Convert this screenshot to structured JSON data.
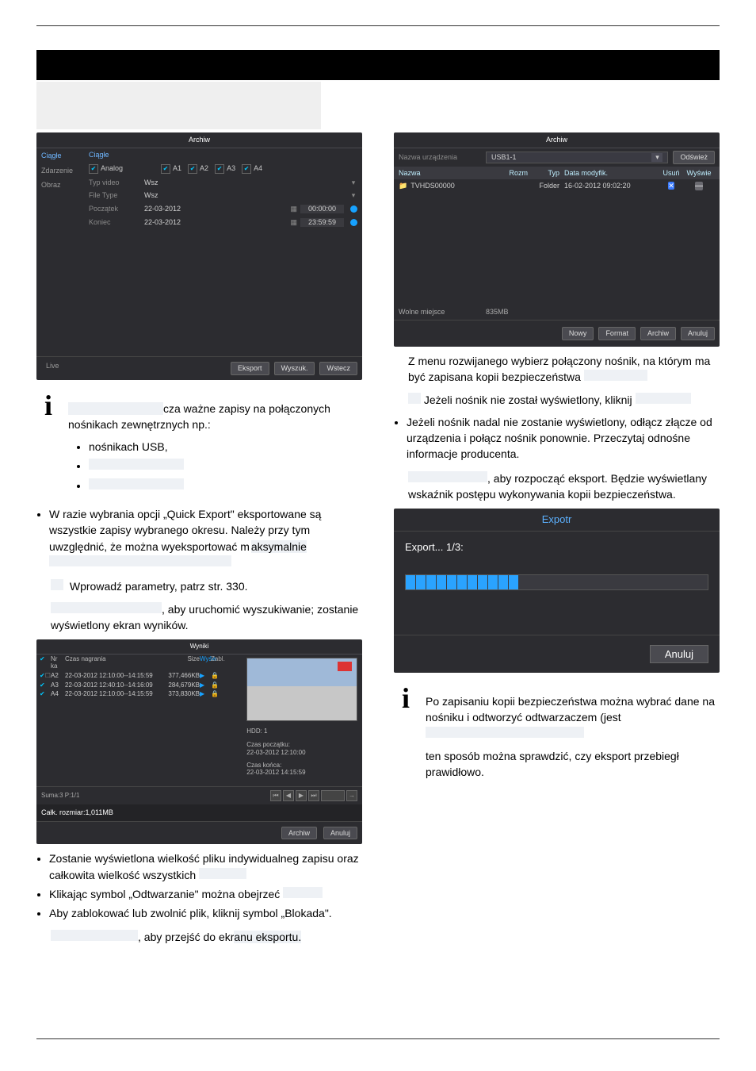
{
  "section_number": "",
  "ss1": {
    "title": "Archiw",
    "sidebar": [
      "Ciągłe",
      "Zdarzenie",
      "Obraz",
      "Live"
    ],
    "tab_active": "Ciągłe",
    "analog_label": "Analog",
    "chs": [
      "A1",
      "A2",
      "A3",
      "A4"
    ],
    "rows": [
      {
        "label": "Typ video",
        "value": "Wsz"
      },
      {
        "label": "File Type",
        "value": "Wsz"
      },
      {
        "label": "Początek",
        "value": "22-03-2012",
        "time": "00:00:00"
      },
      {
        "label": "Koniec",
        "value": "22-03-2012",
        "time": "23:59:59"
      }
    ],
    "buttons": [
      "Eksport",
      "Wyszuk.",
      "Wstecz"
    ]
  },
  "intro_right": "cza ważne zapisy na połączonych nośnikach zewnętrznych np.:",
  "media_list": [
    "nośnikach USB,",
    "",
    ""
  ],
  "quick_export": "W razie wybrania opcji „Quick Export\" eksportowane są wszystkie zapisy wybranego okresu. Należy przy tym uwzględnić, że można wyeksportować m",
  "enter_params_label": "Wprowadź parametry, patrz str. 330.",
  "search_line": ", aby uruchomić wyszukiwanie; zostanie wyświetlony ekran wyników.",
  "ss2": {
    "title": "Wyniki",
    "head": [
      "Nr ka",
      "Czas nagrania",
      "Size",
      "Wyśw",
      "Zabl."
    ],
    "rows": [
      {
        "ch": "A2",
        "time": "22-03-2012 12:10:00--14:15:59",
        "size": "377,466KB"
      },
      {
        "ch": "A3",
        "time": "22-03-2012 12:40:10--14:16:09",
        "size": "284,679KB"
      },
      {
        "ch": "A4",
        "time": "22-03-2012 12:10:00--14:15:59",
        "size": "373,830KB"
      }
    ],
    "hdd": "HDD: 1",
    "start_lbl": "Czas początku:",
    "start_val": "22-03-2012 12:10:00",
    "end_lbl": "Czas końca:",
    "end_val": "22-03-2012 14:15:59",
    "sum": "Suma:3 P:1/1",
    "total": "Całk. rozmiar:1,011MB",
    "buttons": [
      "Archiw",
      "Anuluj"
    ]
  },
  "below_results": [
    "Zostanie wyświetlona wielkość pliku indywidualneg zapisu oraz całkowita wielkość wszystkich",
    "Klikając symbol „Odtwarzanie\" można obejrzeć",
    "Aby zablokować lub zwolnić plik, kliknij symbol „Blokada\"."
  ],
  "goto_line": ", aby przejść do ekr",
  "ss3": {
    "title": "Archiw",
    "device_label": "Nazwa urządzenia",
    "device_value": "USB1-1",
    "refresh": "Odśwież",
    "head": {
      "name": "Nazwa",
      "size": "Rozm",
      "type": "Typ",
      "date": "Data modyfik.",
      "del": "Usuń",
      "play": "Wyświe"
    },
    "row": {
      "name": "TVHDS00000",
      "type": "Folder",
      "date": "16-02-2012 09:02:20"
    },
    "free_label": "Wolne miejsce",
    "free_value": "835MB",
    "buttons": [
      "Nowy",
      "Format",
      "Archiw",
      "Anuluj"
    ]
  },
  "right_para1": "Z menu rozwijanego wybierz połączony nośnik, na którym ma być zapisana kopii bezpieczeństwa",
  "right_update_line": "Jeżeli nośnik nie został wyświetlony, kliknij",
  "right_reconnect": "Jeżeli nośnik nadal nie zostanie wyświetlony, odłącz złącze od urządzenia i połącz nośnik ponownie. Przeczytaj odnośne informacje producenta.",
  "right_export_line": ", aby rozpocząć eksport. Będzie wyświetlany wskaźnik postępu wykonywania kopii bezpieczeństwa.",
  "ss4": {
    "title": "Expotr",
    "progress_label": "Export... 1/3:",
    "cancel": "Anuluj"
  },
  "note2_line1": "Po zapisaniu kopii bezpieczeństwa można wybrać dane na nośniku i odtworzyć odtwarzaczem (jest",
  "note2_line2": "ten sposób można sprawdzić, czy eksport przebiegł prawidłowo."
}
